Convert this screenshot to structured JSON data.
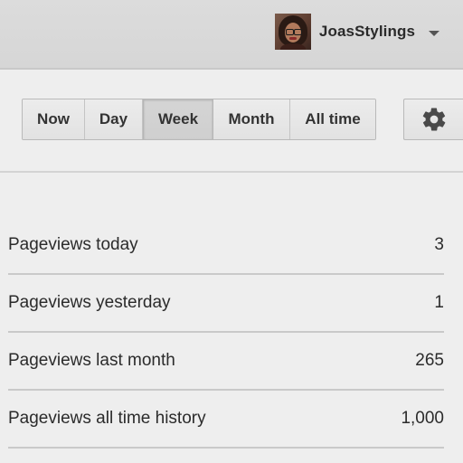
{
  "header": {
    "account_name": "JoasStylings",
    "avatar_icon": "user-avatar-photo",
    "menu_icon": "caret-down-icon"
  },
  "range_tabs": [
    {
      "label": "Now",
      "selected": false
    },
    {
      "label": "Day",
      "selected": false
    },
    {
      "label": "Week",
      "selected": true
    },
    {
      "label": "Month",
      "selected": false
    },
    {
      "label": "All time",
      "selected": false
    }
  ],
  "settings": {
    "icon": "gear-icon"
  },
  "stats": [
    {
      "label": "Pageviews today",
      "value": "3"
    },
    {
      "label": "Pageviews yesterday",
      "value": "1"
    },
    {
      "label": "Pageviews last month",
      "value": "265"
    },
    {
      "label": "Pageviews all time history",
      "value": "1,000"
    }
  ],
  "colors": {
    "background": "#eeeeee",
    "header": "#d8d8d8",
    "text": "#2b2b2b",
    "selected_tab": "#d2d2d2"
  }
}
